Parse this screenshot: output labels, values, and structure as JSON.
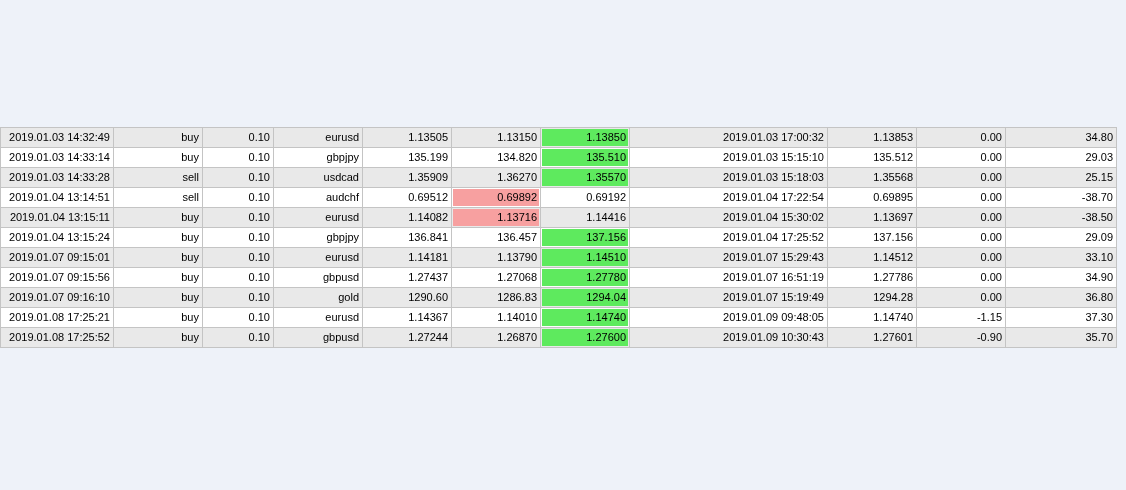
{
  "table": {
    "rows": [
      {
        "cells": [
          "2019.01.03 14:32:49",
          "buy",
          "0.10",
          "eurusd",
          "1.13505",
          "1.13150",
          "1.13850",
          "2019.01.03 17:00:32",
          "1.13853",
          "0.00",
          "34.80"
        ],
        "sl_hit": false,
        "tp_hit": true
      },
      {
        "cells": [
          "2019.01.03 14:33:14",
          "buy",
          "0.10",
          "gbpjpy",
          "135.199",
          "134.820",
          "135.510",
          "2019.01.03 15:15:10",
          "135.512",
          "0.00",
          "29.03"
        ],
        "sl_hit": false,
        "tp_hit": true
      },
      {
        "cells": [
          "2019.01.03 14:33:28",
          "sell",
          "0.10",
          "usdcad",
          "1.35909",
          "1.36270",
          "1.35570",
          "2019.01.03 15:18:03",
          "1.35568",
          "0.00",
          "25.15"
        ],
        "sl_hit": false,
        "tp_hit": true
      },
      {
        "cells": [
          "2019.01.04 13:14:51",
          "sell",
          "0.10",
          "audchf",
          "0.69512",
          "0.69892",
          "0.69192",
          "2019.01.04 17:22:54",
          "0.69895",
          "0.00",
          "-38.70"
        ],
        "sl_hit": true,
        "tp_hit": false
      },
      {
        "cells": [
          "2019.01.04 13:15:11",
          "buy",
          "0.10",
          "eurusd",
          "1.14082",
          "1.13716",
          "1.14416",
          "2019.01.04 15:30:02",
          "1.13697",
          "0.00",
          "-38.50"
        ],
        "sl_hit": true,
        "tp_hit": false
      },
      {
        "cells": [
          "2019.01.04 13:15:24",
          "buy",
          "0.10",
          "gbpjpy",
          "136.841",
          "136.457",
          "137.156",
          "2019.01.04 17:25:52",
          "137.156",
          "0.00",
          "29.09"
        ],
        "sl_hit": false,
        "tp_hit": true
      },
      {
        "cells": [
          "2019.01.07 09:15:01",
          "buy",
          "0.10",
          "eurusd",
          "1.14181",
          "1.13790",
          "1.14510",
          "2019.01.07 15:29:43",
          "1.14512",
          "0.00",
          "33.10"
        ],
        "sl_hit": false,
        "tp_hit": true
      },
      {
        "cells": [
          "2019.01.07 09:15:56",
          "buy",
          "0.10",
          "gbpusd",
          "1.27437",
          "1.27068",
          "1.27780",
          "2019.01.07 16:51:19",
          "1.27786",
          "0.00",
          "34.90"
        ],
        "sl_hit": false,
        "tp_hit": true
      },
      {
        "cells": [
          "2019.01.07 09:16:10",
          "buy",
          "0.10",
          "gold",
          "1290.60",
          "1286.83",
          "1294.04",
          "2019.01.07 15:19:49",
          "1294.28",
          "0.00",
          "36.80"
        ],
        "sl_hit": false,
        "tp_hit": true
      },
      {
        "cells": [
          "2019.01.08 17:25:21",
          "buy",
          "0.10",
          "eurusd",
          "1.14367",
          "1.14010",
          "1.14740",
          "2019.01.09 09:48:05",
          "1.14740",
          "-1.15",
          "37.30"
        ],
        "sl_hit": false,
        "tp_hit": true
      },
      {
        "cells": [
          "2019.01.08 17:25:52",
          "buy",
          "0.10",
          "gbpusd",
          "1.27244",
          "1.26870",
          "1.27600",
          "2019.01.09 10:30:43",
          "1.27601",
          "-0.90",
          "35.70"
        ],
        "sl_hit": false,
        "tp_hit": true
      }
    ]
  }
}
